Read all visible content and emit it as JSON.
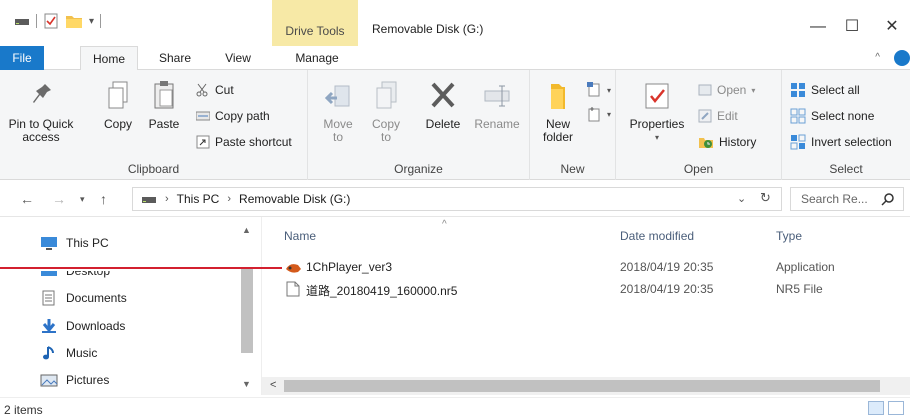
{
  "title_bar": {
    "contextual_tab": "Drive Tools",
    "window_title": "Removable Disk (G:)",
    "minimize": "—",
    "maximize": "☐",
    "close": "✕"
  },
  "ribbon_tabs": {
    "file": "File",
    "home": "Home",
    "share": "Share",
    "view": "View",
    "manage": "Manage"
  },
  "clipboard": {
    "label": "Clipboard",
    "pin": "Pin to Quick access",
    "copy": "Copy",
    "paste": "Paste",
    "cut": "Cut",
    "copy_path": "Copy path",
    "paste_shortcut": "Paste shortcut"
  },
  "organize": {
    "label": "Organize",
    "move_to": "Move to",
    "copy_to": "Copy to",
    "delete": "Delete",
    "rename": "Rename"
  },
  "new_group": {
    "label": "New",
    "new_folder": "New folder"
  },
  "open_group": {
    "label": "Open",
    "properties": "Properties",
    "open": "Open",
    "edit": "Edit",
    "history": "History"
  },
  "select_group": {
    "label": "Select",
    "select_all": "Select all",
    "select_none": "Select none",
    "invert_selection": "Invert selection"
  },
  "address_bar": {
    "crumbs": [
      "This PC",
      "Removable Disk (G:)"
    ],
    "search_placeholder": "Search Re..."
  },
  "nav_pane": {
    "items": [
      "This PC",
      "Desktop",
      "Documents",
      "Downloads",
      "Music",
      "Pictures"
    ]
  },
  "file_list": {
    "columns": {
      "name": "Name",
      "date_modified": "Date modified",
      "type": "Type"
    },
    "rows": [
      {
        "name": "1ChPlayer_ver3",
        "date": "2018/04/19 20:35",
        "type": "Application"
      },
      {
        "name": "道路_20180419_160000.nr5",
        "date": "2018/04/19 20:35",
        "type": "NR5 File"
      }
    ]
  },
  "status_bar": {
    "item_count": "2 items"
  },
  "colors": {
    "accent": "#1979ca",
    "drive_tools": "#f7e9a6",
    "callout": "#d3202f"
  }
}
